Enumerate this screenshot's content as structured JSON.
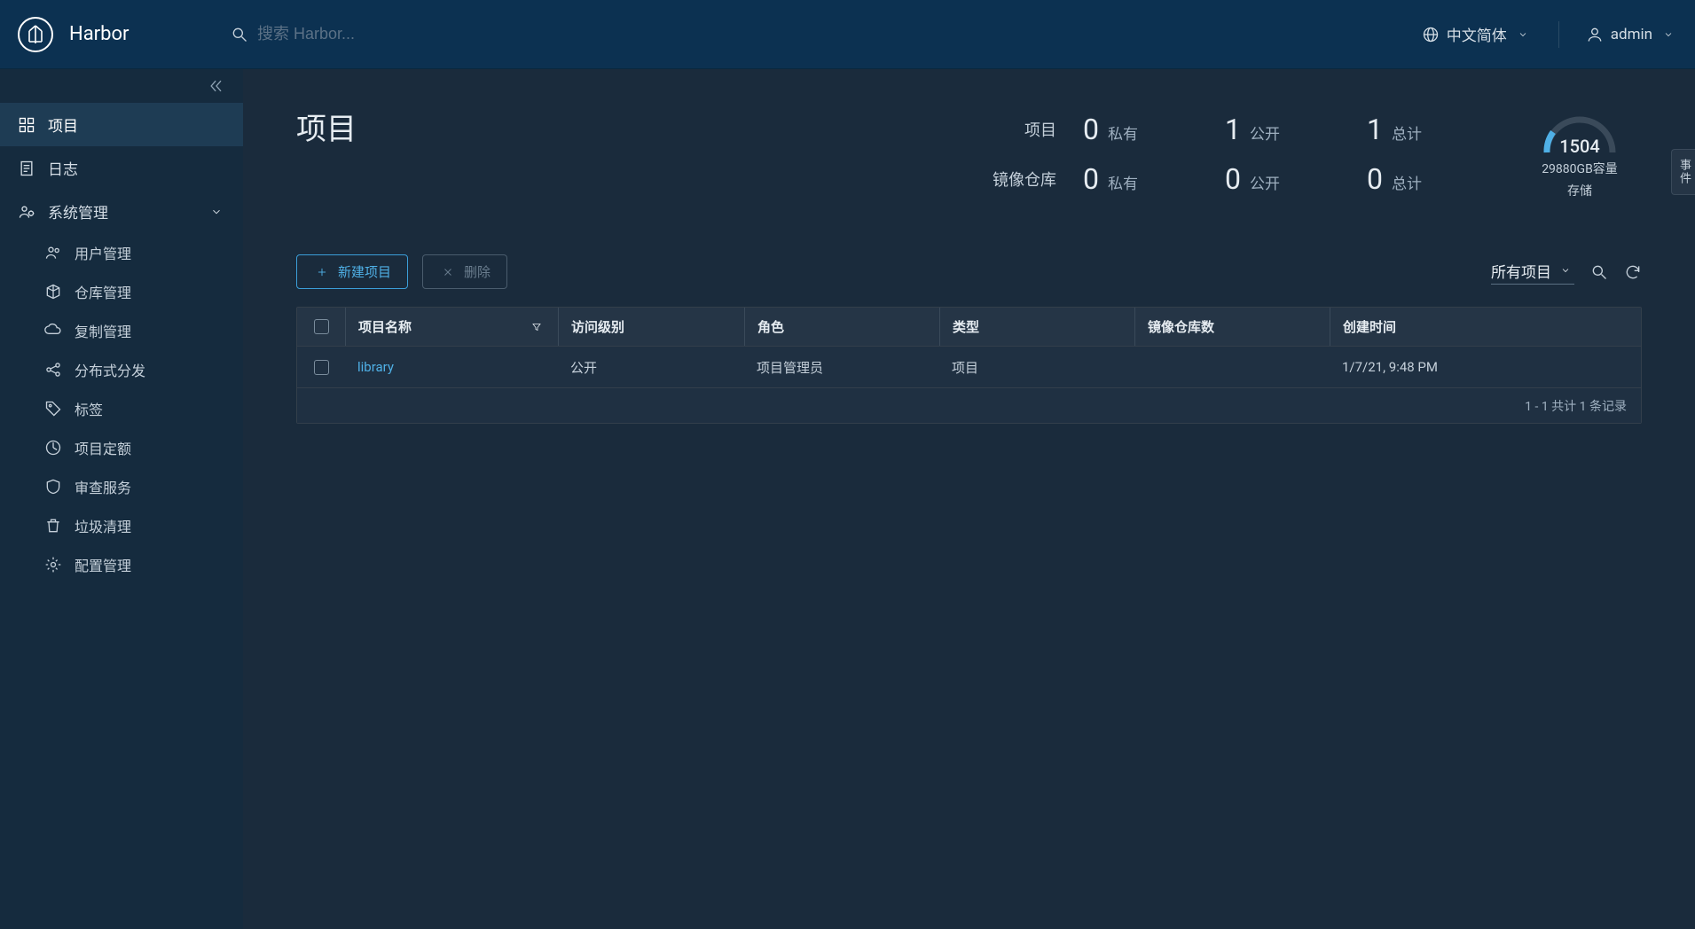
{
  "header": {
    "brand": "Harbor",
    "search_placeholder": "搜索 Harbor...",
    "language": "中文简体",
    "user": "admin"
  },
  "sidebar": {
    "projects": "项目",
    "logs": "日志",
    "admin": "系统管理",
    "admin_items": {
      "users": "用户管理",
      "registries": "仓库管理",
      "replication": "复制管理",
      "distribution": "分布式分发",
      "labels": "标签",
      "quotas": "项目定额",
      "interrogation": "审查服务",
      "gc": "垃圾清理",
      "config": "配置管理"
    }
  },
  "page": {
    "title": "项目",
    "stats": {
      "row1_label": "项目",
      "row2_label": "镜像仓库",
      "private_label": "私有",
      "public_label": "公开",
      "total_label": "总计",
      "projects_private": "0",
      "projects_public": "1",
      "projects_total": "1",
      "repos_private": "0",
      "repos_public": "0",
      "repos_total": "0"
    },
    "storage": {
      "gauge_value": "1504",
      "capacity_line": "29880GB容量",
      "label": "存储"
    }
  },
  "toolbar": {
    "new_project": "新建项目",
    "delete": "删除",
    "filter_label": "所有项目"
  },
  "table": {
    "columns": {
      "name": "项目名称",
      "access": "访问级别",
      "role": "角色",
      "type": "类型",
      "repos": "镜像仓库数",
      "created": "创建时间"
    },
    "rows": [
      {
        "name": "library",
        "access": "公开",
        "role": "项目管理员",
        "type": "项目",
        "repos": "",
        "created": "1/7/21, 9:48 PM"
      }
    ],
    "footer": "1 - 1 共计 1 条记录"
  },
  "rail": {
    "label": "事件"
  }
}
